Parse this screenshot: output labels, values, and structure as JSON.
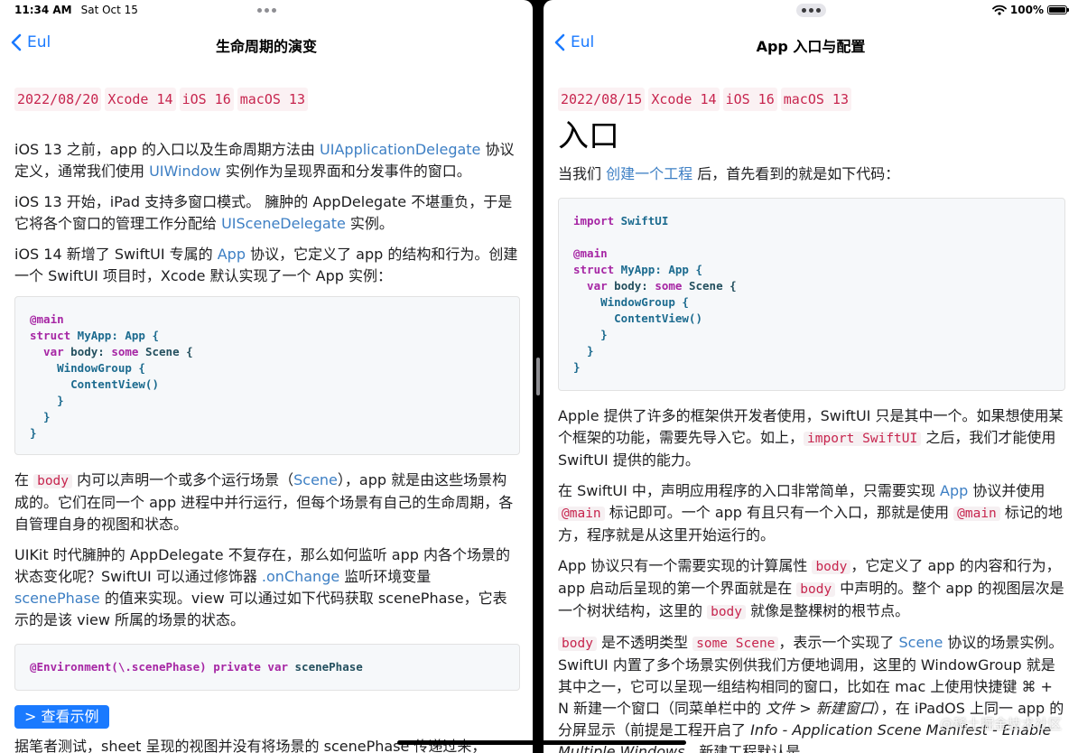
{
  "status_bar": {
    "time": "11:34 AM",
    "date": "Sat Oct 15",
    "battery": "100%"
  },
  "left": {
    "back_label": "Eul",
    "title": "生命周期的演变",
    "tags": [
      "2022/08/20",
      "Xcode 14",
      "iOS 16",
      "macOS 13"
    ],
    "p1": {
      "a": "iOS 13 之前，app 的入口以及生命周期方法由 ",
      "l1": "UIApplicationDelegate",
      "b": " 协议定义，通常我们使用 ",
      "l2": "UIWindow",
      "c": " 实例作为呈现界面和分发事件的窗口。"
    },
    "p2": {
      "a": "iOS 13 开始，iPad 支持多窗口模式。 臃肿的 AppDelegate 不堪重负，于是它将各个窗口的管理工作分配给 ",
      "l1": "UISceneDelegate",
      "b": " 实例。"
    },
    "p3": {
      "a": "iOS 14 新增了 SwiftUI 专属的 ",
      "l1": "App",
      "b": " 协议，它定义了 app 的结构和行为。创建一个 SwiftUI 项目时，Xcode 默认实现了一个 App 实例："
    },
    "code1": {
      "l1a": "@main",
      "l2a": "struct",
      "l2b": " MyApp",
      "l2c": ": App {",
      "l3a": "  var",
      "l3b": " body",
      "l3c": ": ",
      "l3d": "some",
      "l3e": " Scene {",
      "l4": "    WindowGroup {",
      "l5": "      ContentView()",
      "l6": "    }",
      "l7": "  }",
      "l8": "}"
    },
    "p4": {
      "a": "在 ",
      "c1": "body",
      "b": " 内可以声明一个或多个运行场景（",
      "l1": "Scene",
      "c": "），app 就是由这些场景构成的。它们在同一个 app 进程中并行运行，但每个场景有自己的生命周期，各自管理自身的视图和状态。"
    },
    "p5": {
      "a": "UIKit 时代臃肿的 AppDelegate 不复存在，那么如何监听 app 内各个场景的状态变化呢？SwiftUI 可以通过修饰器 ",
      "l1": ".onChange",
      "b": " 监听环境变量 ",
      "l2": "scenePhase",
      "c": " 的值来实现。view 可以通过如下代码获取 scenePhase，它表示的是该 view 所属的场景的状态。"
    },
    "code2": {
      "a": "@Environment(\\.scenePhase)",
      "b": " private",
      "c": " var",
      "d": " scenePhase"
    },
    "button": "> 查看示例",
    "p6": "据笔者测试，sheet 呈现的视图并没有将场景的 scenePhase 传递过来，"
  },
  "right": {
    "back_label": "Eul",
    "title": "App 入口与配置",
    "tags": [
      "2022/08/15",
      "Xcode 14",
      "iOS 16",
      "macOS 13"
    ],
    "heading": "入口",
    "p1": {
      "a": "当我们 ",
      "l1": "创建一个工程",
      "b": " 后，首先看到的就是如下代码："
    },
    "code": {
      "l1a": "import",
      "l1b": " SwiftUI",
      "l2": "",
      "l3a": "@main",
      "l4a": "struct",
      "l4b": " MyApp",
      "l4c": ": App {",
      "l5a": "  var",
      "l5b": " body",
      "l5c": ": ",
      "l5d": "some",
      "l5e": " Scene {",
      "l6": "    WindowGroup {",
      "l7": "      ContentView()",
      "l8": "    }",
      "l9": "  }",
      "l10": "}"
    },
    "p2": {
      "a": "Apple 提供了许多的框架供开发者使用，SwiftUI 只是其中一个。如果想使用某个框架的功能，需要先导入它。如上，",
      "c1": "import SwiftUI",
      "b": " 之后，我们才能使用 SwiftUI 提供的能力。"
    },
    "p3": {
      "a": "在 SwiftUI 中，声明应用程序的入口非常简单，只需要实现 ",
      "l1": "App",
      "b": " 协议并使用 ",
      "c1": "@main",
      "c": " 标记即可。一个 app 有且只有一个入口，那就是使用 ",
      "c2": "@main",
      "d": " 标记的地方，程序就是从这里开始运行的。"
    },
    "p4": {
      "a": "App 协议只有一个需要实现的计算属性 ",
      "c1": "body",
      "b": "，它定义了 app 的内容和行为，app 启动后呈现的第一个界面就是在 ",
      "c2": "body",
      "c": " 中声明的。整个 app 的视图层次是一个树状结构，这里的 ",
      "c3": "body",
      "d": " 就像是整棵树的根节点。"
    },
    "p5": {
      "c1": "body",
      "a": " 是不透明类型 ",
      "c2": "some Scene",
      "b": "，表示一个实现了 ",
      "l1": "Scene",
      "c": " 协议的场景实例。SwiftUI 内置了多个场景实例供我们方便地调用，这里的 WindowGroup 就是其中之一，它可以呈现一组结构相同的窗口，比如在 mac 上使用快捷键 ⌘ + N 新建一个窗口（同菜单栏中的 ",
      "e1": "文件 > 新建窗口",
      "d": "），在 iPadOS 上同一 app 的分屏显示（前提是工程开启了 ",
      "e2": "Info - Application Scene Manifest - Enable Multiple Windows",
      "e": "，新建工程默认是"
    },
    "watermark": "@稀土掘金技术社区"
  }
}
